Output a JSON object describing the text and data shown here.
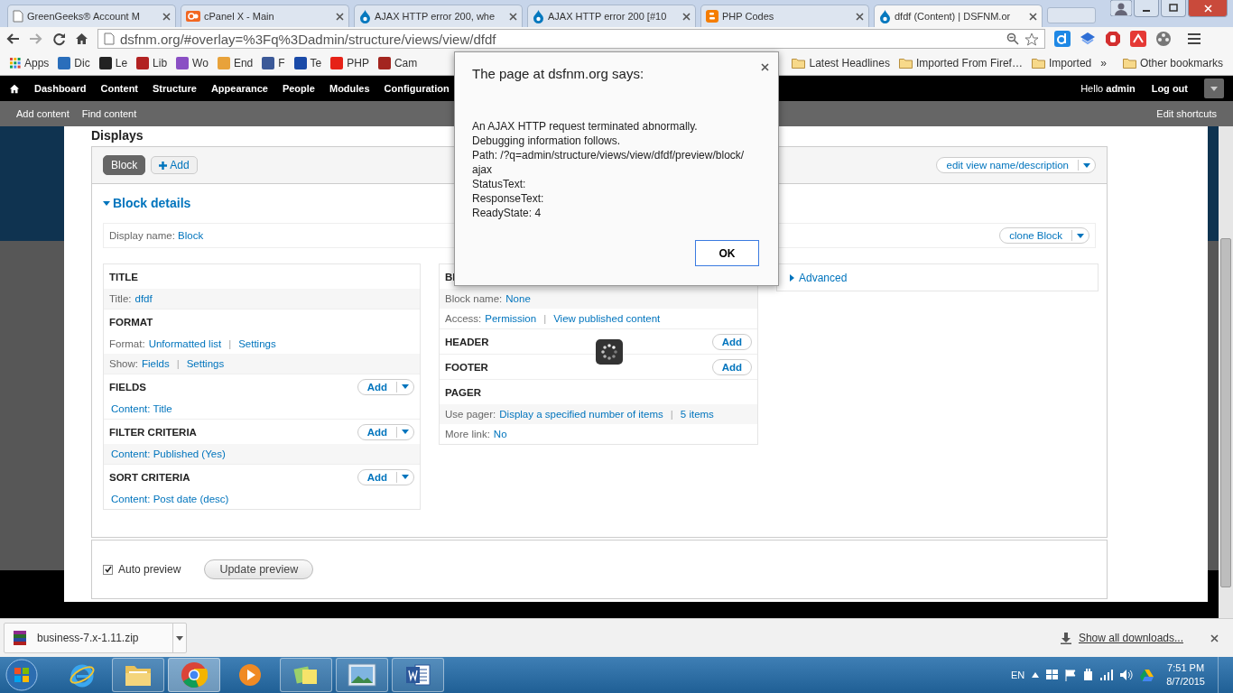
{
  "browser": {
    "tabs": [
      {
        "title": "GreenGeeks® Account M",
        "kind": "doc",
        "selected": false
      },
      {
        "title": "cPanel X - Main",
        "kind": "cpanel",
        "selected": false
      },
      {
        "title": "AJAX HTTP error 200, whe",
        "kind": "drupal",
        "selected": false
      },
      {
        "title": "AJAX HTTP error 200 [#10",
        "kind": "drupal",
        "selected": false
      },
      {
        "title": "PHP Codes",
        "kind": "blogger",
        "selected": false
      },
      {
        "title": "dfdf (Content) | DSFNM.or",
        "kind": "drupal",
        "selected": true
      }
    ],
    "address": "dsfnm.org/#overlay=%3Fq%3Dadmin/structure/views/view/dfdf",
    "bookmarks": [
      {
        "label": "Apps",
        "kind": "apps"
      },
      {
        "label": "Dic",
        "kind": "site",
        "color": "#2a6ebb"
      },
      {
        "label": "Le",
        "kind": "site",
        "color": "#222222"
      },
      {
        "label": "Lib",
        "kind": "site",
        "color": "#b22222"
      },
      {
        "label": "Wo",
        "kind": "site",
        "color": "#8a4fc4"
      },
      {
        "label": "End",
        "kind": "site",
        "color": "#e8a23a"
      },
      {
        "label": "F",
        "kind": "site",
        "color": "#3b5998"
      },
      {
        "label": "Te",
        "kind": "site",
        "color": "#1a4aa8"
      },
      {
        "label": "PHP",
        "kind": "site",
        "color": "#e62117"
      },
      {
        "label": "Cam",
        "kind": "site",
        "color": "#a3251f"
      }
    ],
    "bookmark_folders": [
      "Latest Headlines",
      "Imported From Firef…",
      "Imported"
    ],
    "overflow": "»",
    "other_bookmarks": "Other bookmarks"
  },
  "admin_menu": {
    "items": [
      "Dashboard",
      "Content",
      "Structure",
      "Appearance",
      "People",
      "Modules",
      "Configuration"
    ],
    "greeting": "Hello **admin**",
    "logout": "Log out"
  },
  "shortcuts": {
    "items": [
      "Add content",
      "Find content"
    ],
    "edit": "Edit shortcuts"
  },
  "views": {
    "heading": "Displays",
    "displays": [
      {
        "label": "Block",
        "selected": true
      }
    ],
    "add_display": "Add",
    "edit_view": {
      "label": "edit view name/description",
      "dropdown": true
    },
    "details": {
      "title": "Block details",
      "expanded": true
    },
    "display_name": {
      "label": "Display name:",
      "value": "Block"
    },
    "clone": {
      "label": "clone Block",
      "dropdown": true
    },
    "columns": [
      [
        {
          "title": "TITLE",
          "rows": [
            {
              "label": "Title:",
              "links": [
                "dfdf"
              ]
            }
          ]
        },
        {
          "title": "FORMAT",
          "rows": [
            {
              "label": "Format:",
              "links": [
                "Unformatted list",
                "Settings"
              ],
              "separator": "|"
            },
            {
              "label": "Show:",
              "links": [
                "Fields",
                "Settings"
              ],
              "separator": "|"
            }
          ]
        },
        {
          "title": "FIELDS",
          "add": {
            "label": "Add",
            "dropdown": true
          },
          "rows": [
            {
              "links": [
                "Content: Title"
              ]
            }
          ]
        },
        {
          "title": "FILTER CRITERIA",
          "add": {
            "label": "Add",
            "dropdown": true
          },
          "rows": [
            {
              "links": [
                "Content: Published (Yes)"
              ]
            }
          ]
        },
        {
          "title": "SORT CRITERIA",
          "add": {
            "label": "Add",
            "dropdown": true
          },
          "rows": [
            {
              "links": [
                "Content: Post date (desc)"
              ]
            }
          ]
        }
      ],
      [
        {
          "title": "Bl",
          "rows": [
            {
              "label": "Block name:",
              "links": [
                "None"
              ]
            },
            {
              "label": "Access:",
              "links": [
                "Permission",
                "View published content"
              ],
              "separator": "|"
            }
          ]
        },
        {
          "title": "HEADER",
          "add": {
            "label": "Add",
            "dropdown": false
          }
        },
        {
          "title": "FOOTER",
          "add": {
            "label": "Add",
            "dropdown": false
          }
        },
        {
          "title": "PAGER",
          "rows": [
            {
              "label": "Use pager:",
              "links": [
                "Display a specified number of items",
                "5 items"
              ],
              "separator": "|"
            },
            {
              "label": "More link:",
              "links": [
                "No"
              ]
            }
          ]
        }
      ]
    ],
    "advanced": {
      "label": "Advanced",
      "expanded": false
    }
  },
  "preview": {
    "auto_preview": {
      "label": "Auto preview",
      "checked": true
    },
    "update": "Update preview"
  },
  "dialog": {
    "title": "The page at dsfnm.org says:",
    "lines": [
      "An AJAX HTTP request terminated abnormally.",
      "Debugging information follows.",
      "Path: /?q=admin/structure/views/view/dfdf/preview/block/",
      "ajax",
      "StatusText:",
      "ResponseText:",
      "ReadyState: 4"
    ],
    "ok": "OK"
  },
  "downloads": {
    "file": "business-7.x-1.11.zip",
    "show_all": "Show all downloads..."
  },
  "taskbar": {
    "apps": [
      {
        "kind": "ie",
        "running": false,
        "selected": false
      },
      {
        "kind": "explorer",
        "running": true,
        "selected": false
      },
      {
        "kind": "chrome",
        "running": true,
        "selected": true
      },
      {
        "kind": "media",
        "running": false,
        "selected": false
      },
      {
        "kind": "notes",
        "running": true,
        "selected": false
      },
      {
        "kind": "photos",
        "running": true,
        "selected": false
      },
      {
        "kind": "word",
        "running": true,
        "selected": false
      }
    ],
    "language": "EN",
    "time": "7:51 PM",
    "date": "8/7/2015"
  }
}
